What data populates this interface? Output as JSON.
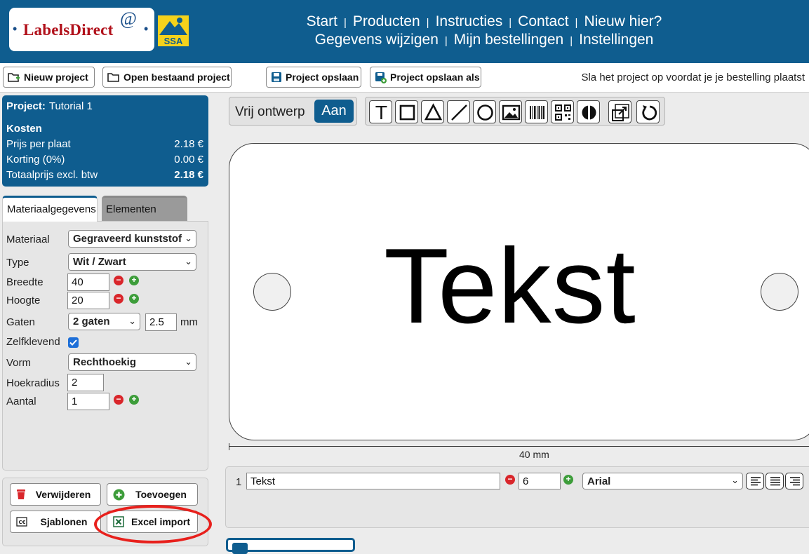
{
  "header": {
    "logo_text": "LabelsDirect",
    "logo_at": "@",
    "ssa_text": "SSA",
    "nav_primary": [
      "Start",
      "Producten",
      "Instructies",
      "Contact",
      "Nieuw hier?"
    ],
    "nav_secondary": [
      "Gegevens wijzigen",
      "Mijn bestellingen",
      "Instellingen"
    ],
    "separator": "|",
    "logo_dot": "•"
  },
  "toolbar": {
    "new_project": "Nieuw project",
    "open_project": "Open bestaand project",
    "save_project": "Project opslaan",
    "save_project_as": "Project opslaan als",
    "save_hint": "Sla het project op voordat je je bestelling plaatst"
  },
  "project": {
    "label": "Project:",
    "name": "Tutorial 1",
    "costs_title": "Kosten",
    "price_per_plate_label": "Prijs per plaat",
    "price_per_plate": "2.18 €",
    "discount_label": "Korting (0%)",
    "discount": "0.00 €",
    "total_label": "Totaalprijs excl. btw",
    "total": "2.18 €"
  },
  "tabs": {
    "material": "Materiaalgegevens",
    "elements": "Elementen"
  },
  "form": {
    "material_label": "Materiaal",
    "material_value": "Gegraveerd kunststof",
    "type_label": "Type",
    "type_value": "Wit / Zwart",
    "width_label": "Breedte",
    "width_value": "40",
    "height_label": "Hoogte",
    "height_value": "20",
    "holes_label": "Gaten",
    "holes_value": "2 gaten",
    "hole_size": "2.5",
    "hole_unit": "mm",
    "adhesive_label": "Zelfklevend",
    "adhesive_checked": true,
    "shape_label": "Vorm",
    "shape_value": "Rechthoekig",
    "radius_label": "Hoekradius",
    "radius_value": "2",
    "quantity_label": "Aantal",
    "quantity_value": "1"
  },
  "actions": {
    "delete": "Verwijderen",
    "add": "Toevoegen",
    "templates": "Sjablonen",
    "excel_import": "Excel import"
  },
  "design": {
    "mode_label": "Vrij ontwerp",
    "mode_state": "Aan",
    "tool_text_glyph": "T"
  },
  "canvas": {
    "text": "Tekst",
    "dimension": "40 mm"
  },
  "element_row": {
    "index": "1",
    "text": "Tekst",
    "size": "6",
    "font": "Arial"
  },
  "colors": {
    "brand_blue": "#0f5d8f",
    "logo_red": "#b1101a",
    "ssa_yellow": "#f4d21c",
    "highlight_red": "#e8201c",
    "minus_red": "#d9262b",
    "plus_green": "#3d9d3a"
  }
}
